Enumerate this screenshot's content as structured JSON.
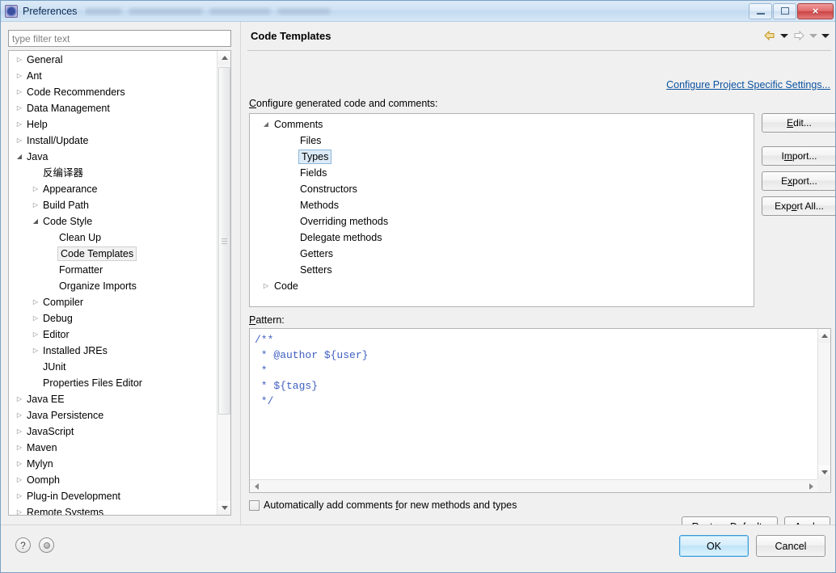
{
  "window": {
    "title": "Preferences",
    "icon": "preferences-gear-icon",
    "buttons": {
      "minimize": "minimize-icon",
      "maximize": "maximize-icon",
      "close": "×"
    }
  },
  "sidebar": {
    "filter": {
      "placeholder": "type filter text",
      "value": ""
    },
    "items": [
      {
        "label": "General",
        "level": 0,
        "twisty": "collapsed",
        "selected": false
      },
      {
        "label": "Ant",
        "level": 0,
        "twisty": "collapsed",
        "selected": false
      },
      {
        "label": "Code Recommenders",
        "level": 0,
        "twisty": "collapsed",
        "selected": false
      },
      {
        "label": "Data Management",
        "level": 0,
        "twisty": "collapsed",
        "selected": false
      },
      {
        "label": "Help",
        "level": 0,
        "twisty": "collapsed",
        "selected": false
      },
      {
        "label": "Install/Update",
        "level": 0,
        "twisty": "collapsed",
        "selected": false
      },
      {
        "label": "Java",
        "level": 0,
        "twisty": "expanded",
        "selected": false
      },
      {
        "label": "反编译器",
        "level": 1,
        "twisty": "none",
        "selected": false
      },
      {
        "label": "Appearance",
        "level": 1,
        "twisty": "collapsed",
        "selected": false
      },
      {
        "label": "Build Path",
        "level": 1,
        "twisty": "collapsed",
        "selected": false
      },
      {
        "label": "Code Style",
        "level": 1,
        "twisty": "expanded",
        "selected": false
      },
      {
        "label": "Clean Up",
        "level": 2,
        "twisty": "none",
        "selected": false
      },
      {
        "label": "Code Templates",
        "level": 2,
        "twisty": "none",
        "selected": true
      },
      {
        "label": "Formatter",
        "level": 2,
        "twisty": "none",
        "selected": false
      },
      {
        "label": "Organize Imports",
        "level": 2,
        "twisty": "none",
        "selected": false
      },
      {
        "label": "Compiler",
        "level": 1,
        "twisty": "collapsed",
        "selected": false
      },
      {
        "label": "Debug",
        "level": 1,
        "twisty": "collapsed",
        "selected": false
      },
      {
        "label": "Editor",
        "level": 1,
        "twisty": "collapsed",
        "selected": false
      },
      {
        "label": "Installed JREs",
        "level": 1,
        "twisty": "collapsed",
        "selected": false
      },
      {
        "label": "JUnit",
        "level": 1,
        "twisty": "none",
        "selected": false
      },
      {
        "label": "Properties Files Editor",
        "level": 1,
        "twisty": "none",
        "selected": false
      },
      {
        "label": "Java EE",
        "level": 0,
        "twisty": "collapsed",
        "selected": false
      },
      {
        "label": "Java Persistence",
        "level": 0,
        "twisty": "collapsed",
        "selected": false
      },
      {
        "label": "JavaScript",
        "level": 0,
        "twisty": "collapsed",
        "selected": false
      },
      {
        "label": "Maven",
        "level": 0,
        "twisty": "collapsed",
        "selected": false
      },
      {
        "label": "Mylyn",
        "level": 0,
        "twisty": "collapsed",
        "selected": false
      },
      {
        "label": "Oomph",
        "level": 0,
        "twisty": "collapsed",
        "selected": false
      },
      {
        "label": "Plug-in Development",
        "level": 0,
        "twisty": "collapsed",
        "selected": false
      },
      {
        "label": "Remote Systems",
        "level": 0,
        "twisty": "collapsed",
        "selected": false
      }
    ]
  },
  "page": {
    "title": "Code Templates",
    "nav": {
      "back_icon": "back-arrow-icon",
      "back_menu_icon": "chevron-down-icon",
      "forward_icon": "forward-arrow-icon",
      "forward_menu_icon": "chevron-down-icon",
      "menu_icon": "chevron-down-icon"
    },
    "project_specific_link": "Configure Project Specific Settings...",
    "section_label": "Configure generated code and comments:",
    "section_label_mnemonic": "C",
    "templates": [
      {
        "label": "Comments",
        "level": 0,
        "twisty": "expanded",
        "selected": false
      },
      {
        "label": "Files",
        "level": 1,
        "twisty": "none",
        "selected": false
      },
      {
        "label": "Types",
        "level": 1,
        "twisty": "none",
        "selected": true
      },
      {
        "label": "Fields",
        "level": 1,
        "twisty": "none",
        "selected": false
      },
      {
        "label": "Constructors",
        "level": 1,
        "twisty": "none",
        "selected": false
      },
      {
        "label": "Methods",
        "level": 1,
        "twisty": "none",
        "selected": false
      },
      {
        "label": "Overriding methods",
        "level": 1,
        "twisty": "none",
        "selected": false
      },
      {
        "label": "Delegate methods",
        "level": 1,
        "twisty": "none",
        "selected": false
      },
      {
        "label": "Getters",
        "level": 1,
        "twisty": "none",
        "selected": false
      },
      {
        "label": "Setters",
        "level": 1,
        "twisty": "none",
        "selected": false
      },
      {
        "label": "Code",
        "level": 0,
        "twisty": "collapsed",
        "selected": false
      }
    ],
    "side_buttons": [
      {
        "label": "Edit...",
        "mnemonic": "E"
      },
      {
        "label": "Import...",
        "mnemonic": "m"
      },
      {
        "label": "Export...",
        "mnemonic": "x"
      },
      {
        "label": "Export All...",
        "mnemonic": "o"
      }
    ],
    "pattern_label": "Pattern:",
    "pattern_label_mnemonic": "P",
    "pattern_value": "/**\n * @author ${user}\n *\n * ${tags}\n */",
    "auto_comment": {
      "label": "Automatically add comments for new methods and types",
      "checked": false
    },
    "restore_defaults_label": "Restore Defaults",
    "apply_label": "Apply"
  },
  "footer": {
    "help_icon": "?",
    "secondary_icon": "status-dot-icon",
    "ok_label": "OK",
    "cancel_label": "Cancel"
  },
  "colors": {
    "titlebar": "#cfe2f4",
    "link": "#0b53a0",
    "selection": "#dcebf7",
    "selection_border": "#8bb7dd",
    "code_text": "#3f5fbf",
    "default_button_border": "#3a9bd9",
    "close_button": "#cc4444"
  }
}
